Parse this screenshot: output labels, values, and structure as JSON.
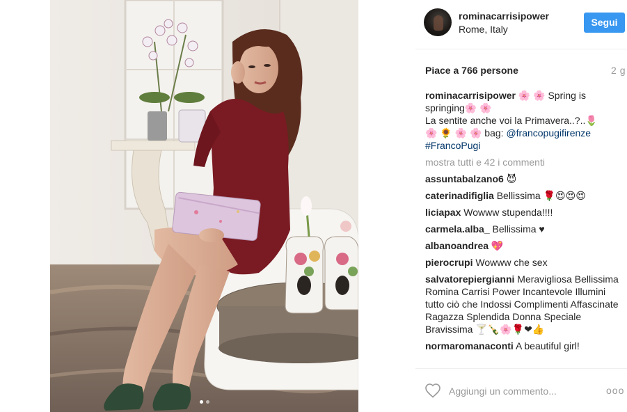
{
  "post": {
    "image_alt": "Woman in burgundy dress seated on a white chair holding a pink clutch",
    "carousel": {
      "count": 2,
      "active": 0
    }
  },
  "header": {
    "username": "rominacarrisipower",
    "location": "Rome, Italy",
    "follow_label": "Segui"
  },
  "stats": {
    "likes": "Piace a 766 persone",
    "time": "2 g"
  },
  "caption": {
    "username": "rominacarrisipower",
    "line1": " 🌸 🌸 Spring is springing🌸 🌸",
    "line2": "La sentite anche voi la Primavera..?..🌷",
    "line3": "🌸 🌻 🌸 🌸 bag: ",
    "mention": "@francopugifirenze",
    "hashtag": "#FrancoPugi"
  },
  "show_all_comments": "mostra tutti e 42 i commenti",
  "comments": [
    {
      "user": "assuntabalzano6",
      "text": "😈"
    },
    {
      "user": "caterinadifiglia",
      "text": "Bellissima 🌹😍😍😍"
    },
    {
      "user": "liciapax",
      "text": "Wowww stupenda!!!!"
    },
    {
      "user": "carmela.alba_",
      "text": "Bellissima ♥"
    },
    {
      "user": "albanoandrea",
      "text": "💖"
    },
    {
      "user": "pierocrupi",
      "text": "Wowww che sex"
    },
    {
      "user": "salvatorepiergianni",
      "text": "Meravigliosa Bellissima Romina Carrisi Power Incantevole Illumini tutto ciò che Indossi Complimenti Affascinate Ragazza Splendida Donna Speciale Bravissima 🍸🍾🌸🌹❤👍"
    },
    {
      "user": "normaromanaconti",
      "text": "A beautiful girl!"
    }
  ],
  "footer": {
    "comment_placeholder": "Aggiungi un commento...",
    "more_label": "ooo"
  },
  "colors": {
    "follow_button": "#3897f0",
    "link": "#003569",
    "muted": "#999999",
    "text": "#262626"
  }
}
